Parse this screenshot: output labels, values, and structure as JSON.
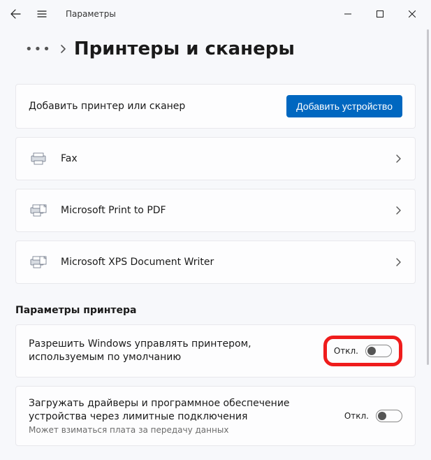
{
  "app": {
    "name": "Параметры"
  },
  "breadcrumb": {
    "title": "Принтеры и сканеры"
  },
  "addCard": {
    "label": "Добавить принтер или сканер",
    "button": "Добавить устройство"
  },
  "printers": [
    {
      "name": "Fax"
    },
    {
      "name": "Microsoft Print to PDF"
    },
    {
      "name": "Microsoft XPS Document Writer"
    }
  ],
  "section": {
    "header": "Параметры принтера"
  },
  "options": {
    "defaultPrinter": {
      "text": "Разрешить Windows управлять принтером, используемым по умолчанию",
      "state": "Откл."
    },
    "metered": {
      "text": "Загружать драйверы и программное обеспечение устройства через лимитные подключения",
      "sub": "Может взиматься плата за передачу данных",
      "state": "Откл."
    }
  }
}
